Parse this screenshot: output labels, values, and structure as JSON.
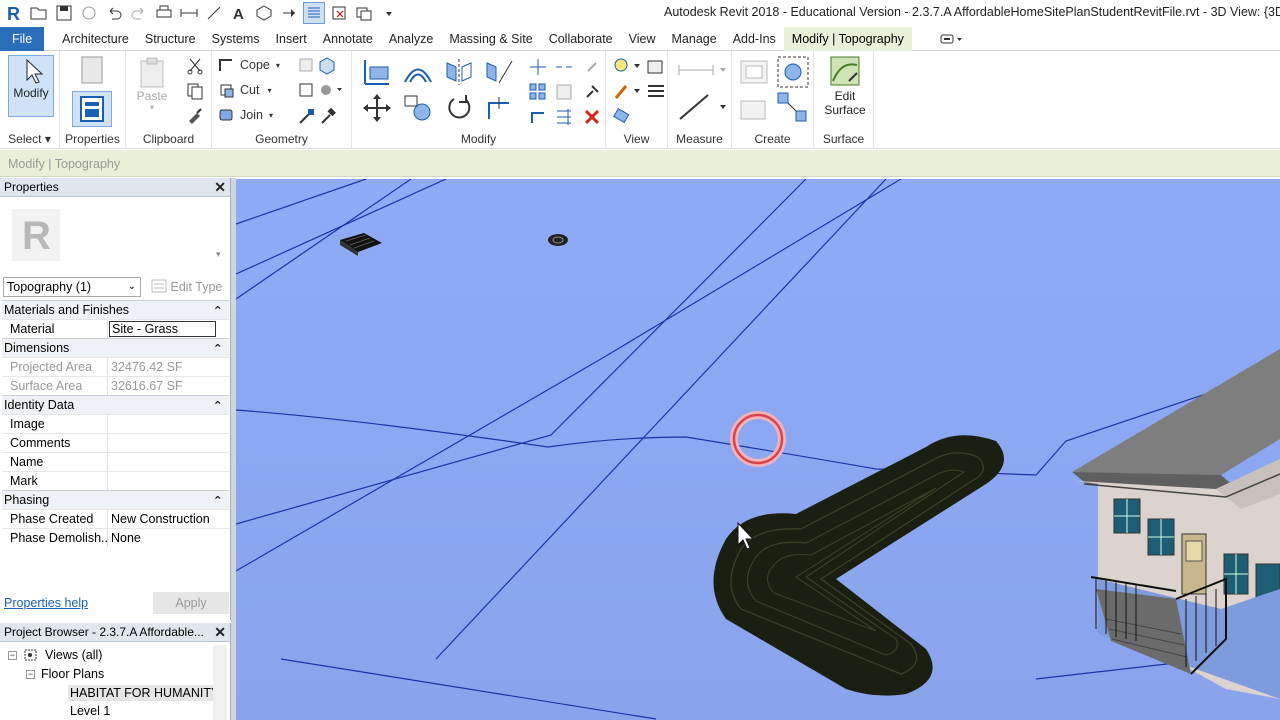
{
  "window": {
    "title": "Autodesk Revit 2018 - Educational Version -    2.3.7.A AffordableHomeSitePlanStudentRevitFile.rvt - 3D View: {3D"
  },
  "tabs": [
    "File",
    "Architecture",
    "Structure",
    "Systems",
    "Insert",
    "Annotate",
    "Analyze",
    "Massing & Site",
    "Collaborate",
    "View",
    "Manage",
    "Add-Ins",
    "Modify | Topography"
  ],
  "active_tab": "Modify | Topography",
  "ribbon": {
    "modify_label": "Modify",
    "select_label": "Select ▾",
    "properties_label": "Properties",
    "paste_label": "Paste",
    "clipboard_label": "Clipboard",
    "cope_label": "Cope",
    "cut_label": "Cut",
    "join_label": "Join",
    "geometry_label": "Geometry",
    "modify_panel_label": "Modify",
    "view_label": "View",
    "measure_label": "Measure",
    "create_label": "Create",
    "edit_surface_label_1": "Edit",
    "edit_surface_label_2": "Surface",
    "surface_label": "Surface"
  },
  "options_bar": {
    "text": "Modify | Topography"
  },
  "properties": {
    "title": "Properties",
    "type_selector": "Topography (1)",
    "edit_type": "Edit Type",
    "groups": [
      {
        "name": "Materials and Finishes",
        "rows": [
          {
            "k": "Material",
            "v": "Site - Grass"
          }
        ]
      },
      {
        "name": "Dimensions",
        "rows": [
          {
            "k": "Projected Area",
            "v": "32476.42 SF"
          },
          {
            "k": "Surface Area",
            "v": "32616.67 SF"
          }
        ]
      },
      {
        "name": "Identity Data",
        "rows": [
          {
            "k": "Image",
            "v": ""
          },
          {
            "k": "Comments",
            "v": ""
          },
          {
            "k": "Name",
            "v": ""
          },
          {
            "k": "Mark",
            "v": ""
          }
        ]
      },
      {
        "name": "Phasing",
        "rows": [
          {
            "k": "Phase Created",
            "v": "New Construction"
          },
          {
            "k": "Phase Demolish...",
            "v": "None"
          }
        ]
      }
    ],
    "help_link": "Properties help",
    "apply_label": "Apply"
  },
  "project_browser": {
    "title": "Project Browser - 2.3.7.A Affordable...",
    "views_all": "Views (all)",
    "floor_plans": "Floor Plans",
    "item_1": "HABITAT FOR HUMANITY",
    "item_2": "Level 1"
  },
  "colors": {
    "viewport_bg": "#8ea9f5",
    "accent": "#2a6ebb",
    "contextual_tab": "#e8f0d8"
  }
}
